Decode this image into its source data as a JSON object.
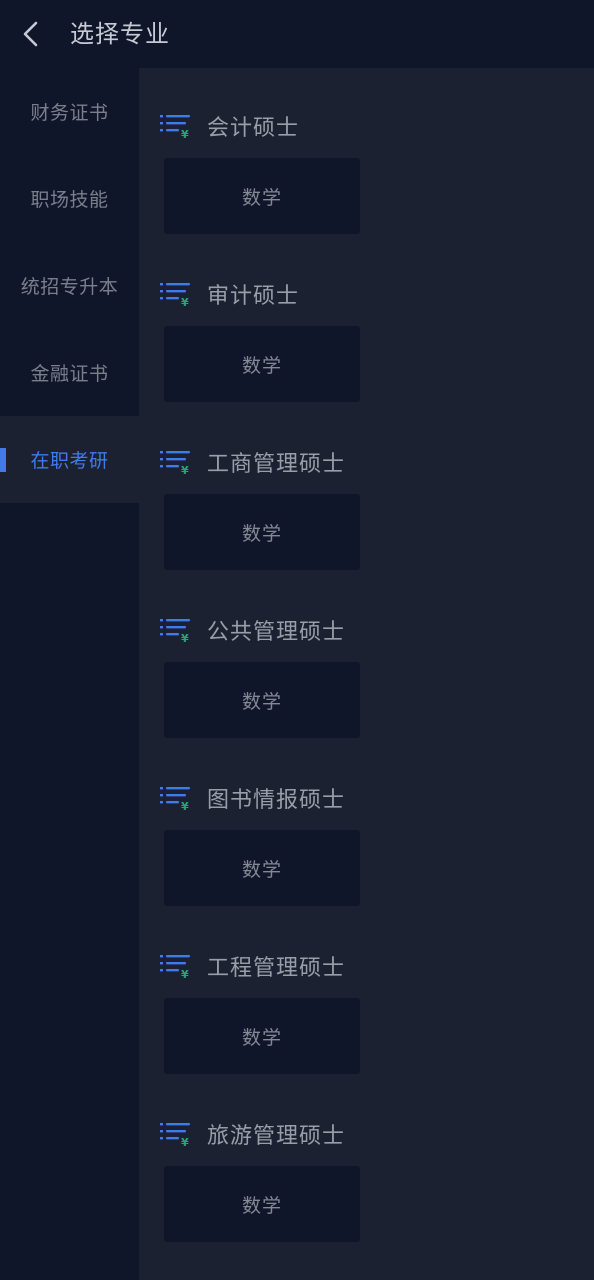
{
  "header": {
    "title": "选择专业",
    "back_icon": "chevron-left-icon"
  },
  "colors": {
    "background": "#0f1629",
    "panel": "#1c2132",
    "accent": "#3f7bea",
    "icon_green": "#2fa07a"
  },
  "sidebar": {
    "active_index": 4,
    "items": [
      {
        "label": "财务证书"
      },
      {
        "label": "职场技能"
      },
      {
        "label": "统招专升本"
      },
      {
        "label": "金融证书"
      },
      {
        "label": "在职考研"
      }
    ]
  },
  "main": {
    "group_icon": "list-yen-icon",
    "groups": [
      {
        "title": "会计硕士",
        "subjects": [
          "数学"
        ]
      },
      {
        "title": "审计硕士",
        "subjects": [
          "数学"
        ]
      },
      {
        "title": "工商管理硕士",
        "subjects": [
          "数学"
        ]
      },
      {
        "title": "公共管理硕士",
        "subjects": [
          "数学"
        ]
      },
      {
        "title": "图书情报硕士",
        "subjects": [
          "数学"
        ]
      },
      {
        "title": "工程管理硕士",
        "subjects": [
          "数学"
        ]
      },
      {
        "title": "旅游管理硕士",
        "subjects": [
          "数学"
        ]
      }
    ]
  }
}
